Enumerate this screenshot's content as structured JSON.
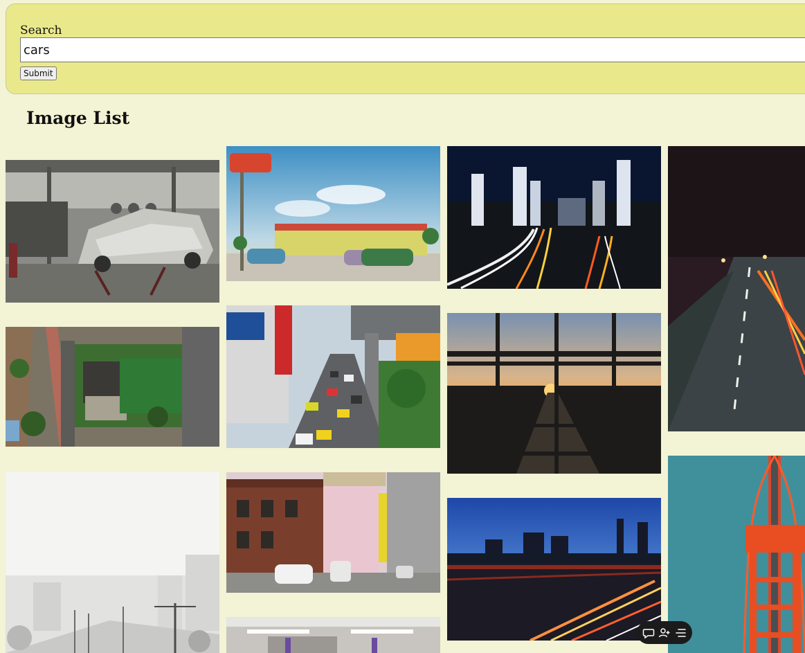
{
  "search": {
    "label": "Search",
    "value": "cars",
    "submit_label": "Submit"
  },
  "main": {
    "title": "Image List"
  },
  "images": [
    {
      "name": "garage-classic-car-image",
      "column": 1,
      "order": 1
    },
    {
      "name": "aerial-house-street-image",
      "column": 1,
      "order": 2
    },
    {
      "name": "foggy-highway-city-image",
      "column": 1,
      "order": 3
    },
    {
      "name": "vintage-carwash-postcard-image",
      "column": 2,
      "order": 1
    },
    {
      "name": "busy-city-traffic-image",
      "column": 2,
      "order": 2
    },
    {
      "name": "street-corner-buildings-image",
      "column": 2,
      "order": 3
    },
    {
      "name": "parking-garage-image",
      "column": 2,
      "order": 4
    },
    {
      "name": "city-night-light-trails-image",
      "column": 3,
      "order": 1
    },
    {
      "name": "sunset-highway-fence-image",
      "column": 3,
      "order": 2
    },
    {
      "name": "skyline-bridge-light-trails-image",
      "column": 3,
      "order": 3
    },
    {
      "name": "night-road-image",
      "column": 4,
      "order": 1
    },
    {
      "name": "red-bridge-aerial-image",
      "column": 4,
      "order": 2
    }
  ],
  "floating_toolbar": {
    "icons": [
      "chat-bubble-icon",
      "user-add-icon",
      "menu-list-icon"
    ]
  }
}
